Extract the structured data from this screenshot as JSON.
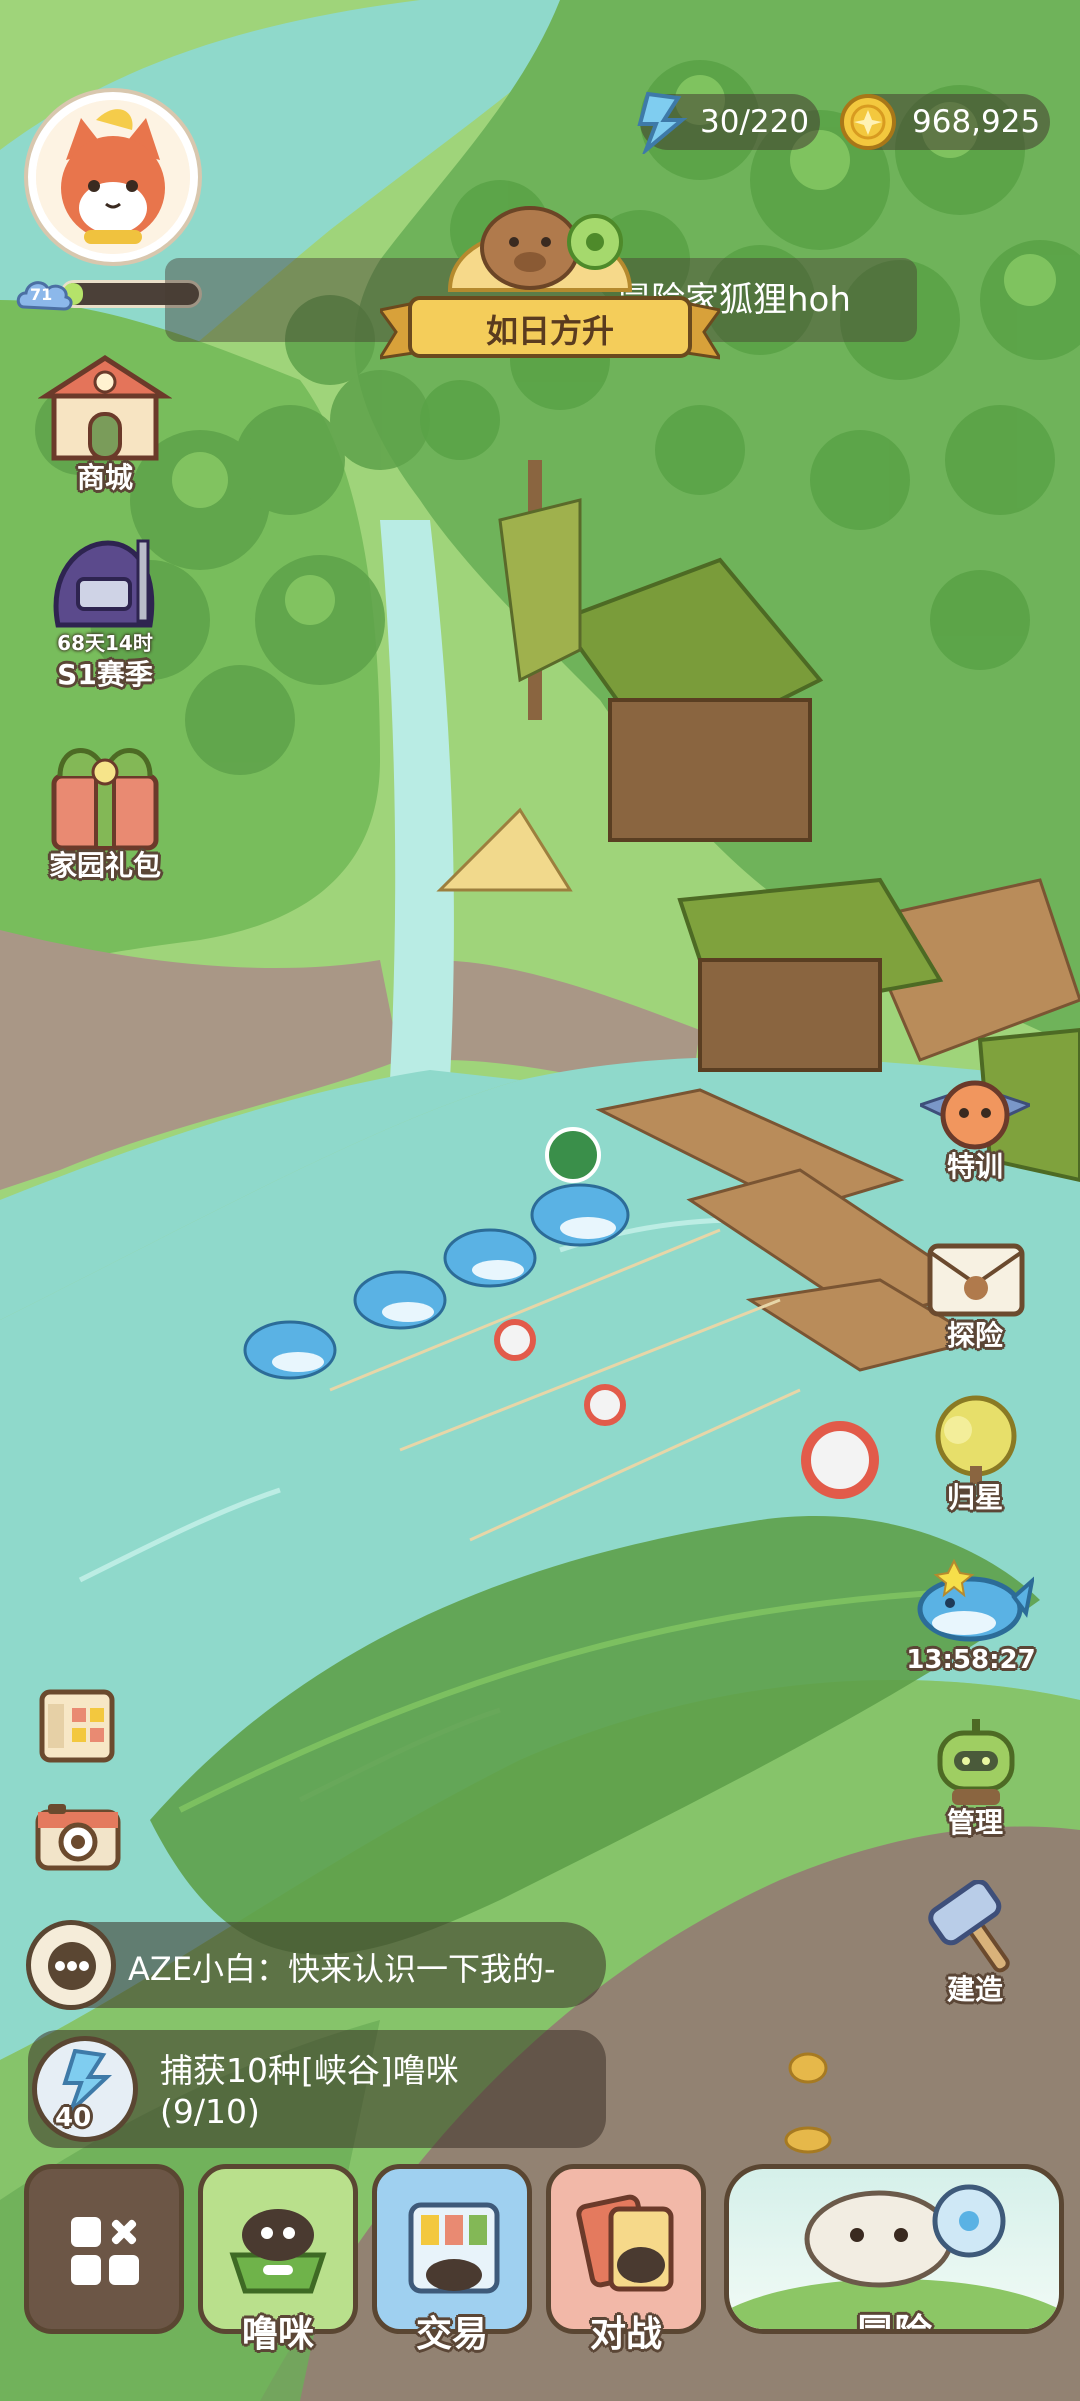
{
  "player": {
    "level": "71",
    "level_progress": 0.15,
    "name": "冒险家狐狸hoh",
    "title": "如日方升"
  },
  "resources": {
    "energy": "30/220",
    "gold": "968,925"
  },
  "left_menu": {
    "shop_label": "商城",
    "season_timer": "68天14时",
    "season_label": "S1赛季",
    "home_gift_label": "家园礼包"
  },
  "right_menu": {
    "training_label": "特训",
    "explore_label": "探险",
    "return_star_label": "归星",
    "whale_timer": "13:58:27",
    "manage_label": "管理",
    "build_label": "建造"
  },
  "chat": {
    "message": "AZE小白：快来认识一下我的-"
  },
  "quest": {
    "energy_cost": "40",
    "line1": "捕获10种[峡谷]噜咪",
    "line2": "(9/10)"
  },
  "bottom_nav": {
    "pets_label": "噜咪",
    "trade_label": "交易",
    "battle_label": "对战",
    "adventure_label": "冒险"
  },
  "colors": {
    "water": "#8fd6c7",
    "foliage": "#7bbf52",
    "wood": "#a77a4c",
    "outline": "#5b4636"
  }
}
